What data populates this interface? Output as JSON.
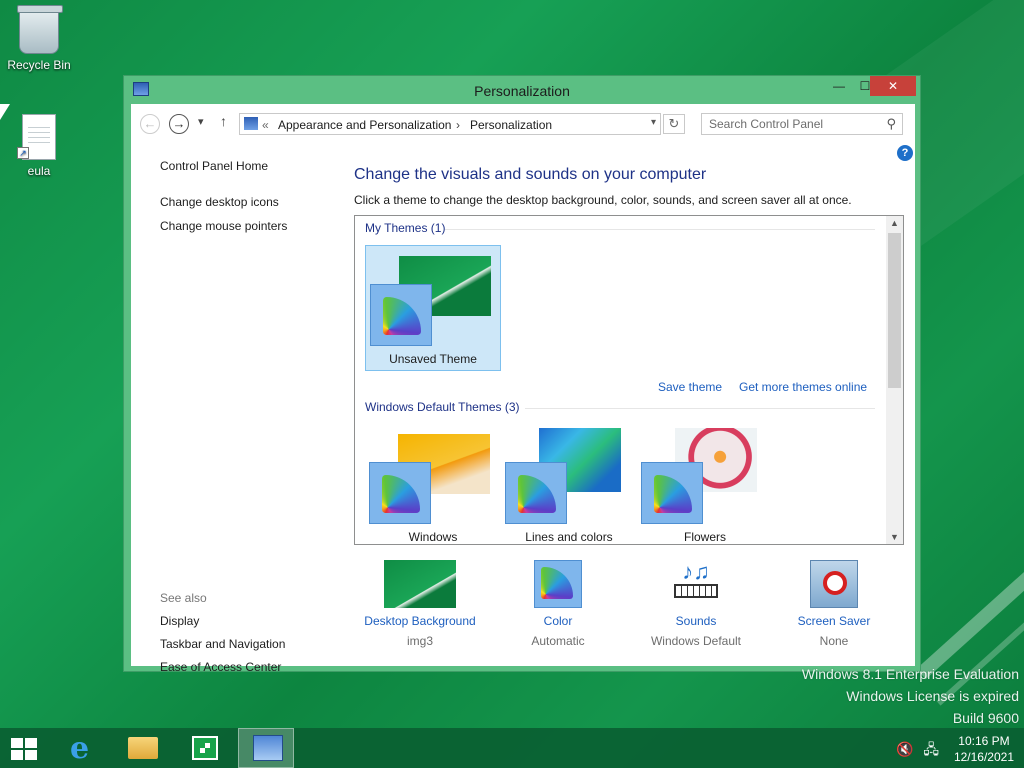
{
  "desktop": {
    "icons": [
      {
        "label": "Recycle Bin"
      },
      {
        "label": "eula"
      }
    ],
    "watermark": [
      "Windows 8.1 Enterprise Evaluation",
      "Windows License is expired",
      "Build 9600"
    ]
  },
  "window": {
    "title": "Personalization",
    "buttons": {
      "minimize": "—",
      "maximize": "☐",
      "close": "✕"
    },
    "address": {
      "chevron": "«",
      "crumbs": [
        "Appearance and Personalization",
        "Personalization"
      ],
      "separator": "›"
    },
    "search": {
      "placeholder": "Search Control Panel"
    },
    "left_pane": {
      "home": "Control Panel Home",
      "links": [
        "Change desktop icons",
        "Change mouse pointers"
      ]
    },
    "see_also": {
      "header": "See also",
      "links": [
        "Display",
        "Taskbar and Navigation",
        "Ease of Access Center"
      ]
    },
    "main": {
      "title": "Change the visuals and sounds on your computer",
      "description": "Click a theme to change the desktop background, color, sounds, and screen saver all at once.",
      "my_themes": {
        "header": "My Themes (1)",
        "items": [
          {
            "label": "Unsaved Theme",
            "selected": true
          }
        ]
      },
      "links": {
        "save": "Save theme",
        "more": "Get more themes online"
      },
      "default_themes": {
        "header": "Windows Default Themes (3)",
        "items": [
          {
            "label": "Windows"
          },
          {
            "label": "Lines and colors"
          },
          {
            "label": "Flowers"
          }
        ]
      }
    },
    "bottom": [
      {
        "label": "Desktop Background",
        "value": "img3"
      },
      {
        "label": "Color",
        "value": "Automatic"
      },
      {
        "label": "Sounds",
        "value": "Windows Default"
      },
      {
        "label": "Screen Saver",
        "value": "None"
      }
    ]
  },
  "taskbar": {
    "apps": [
      "start-icon",
      "internet-explorer-icon",
      "file-explorer-icon",
      "store-icon",
      "control-panel-icon"
    ],
    "clock": {
      "time": "10:16 PM",
      "date": "12/16/2021"
    }
  },
  "colors": {
    "accent": "#1e3287",
    "link": "#1e5fbf",
    "frame": "#5bbf83",
    "selected_tile": "#cde7f8",
    "close": "#c7413a"
  }
}
